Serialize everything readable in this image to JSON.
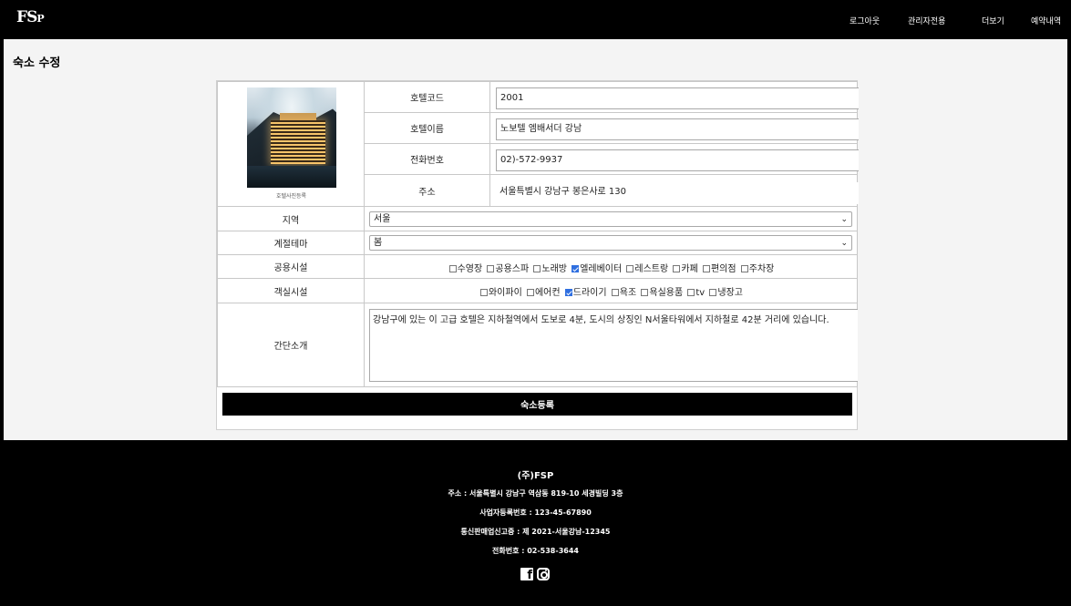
{
  "header": {
    "logo_main": "FS",
    "logo_small": "P",
    "nav": [
      {
        "label": "로그아웃"
      },
      {
        "label": "관리자전용"
      },
      {
        "label": "더보기"
      },
      {
        "label": "예약내역"
      }
    ]
  },
  "page": {
    "title": "숙소 수정"
  },
  "form": {
    "photo_caption": "호텔사진등록",
    "fields": [
      {
        "label": "호텔코드",
        "value": "2001"
      },
      {
        "label": "호텔이름",
        "value": "노보텔 엠배서더 강남"
      },
      {
        "label": "전화번호",
        "value": "02)-572-9937"
      },
      {
        "label": "주소",
        "value": "서울특별시 강남구 봉은사로 130"
      }
    ],
    "region": {
      "label": "지역",
      "selected": "서울"
    },
    "season": {
      "label": "계절테마",
      "selected": "봄"
    },
    "facilities": {
      "label": "공용시설",
      "options": [
        {
          "label": "수영장",
          "checked": false
        },
        {
          "label": "공용스파",
          "checked": false
        },
        {
          "label": "노래방",
          "checked": false
        },
        {
          "label": "엘레베이터",
          "checked": true
        },
        {
          "label": "레스트랑",
          "checked": false
        },
        {
          "label": "카페",
          "checked": false
        },
        {
          "label": "편의점",
          "checked": false
        },
        {
          "label": "주차장",
          "checked": false
        }
      ]
    },
    "room_amenities": {
      "label": "객실시설",
      "options": [
        {
          "label": "와이파이",
          "checked": false
        },
        {
          "label": "에어컨",
          "checked": false
        },
        {
          "label": "드라이기",
          "checked": true
        },
        {
          "label": "욕조",
          "checked": false
        },
        {
          "label": "욕실용품",
          "checked": false
        },
        {
          "label": "tv",
          "checked": false
        },
        {
          "label": "냉장고",
          "checked": false
        }
      ]
    },
    "intro": {
      "label": "간단소개",
      "value": "강남구에 있는 이 고급 호텔은 지하철역에서 도보로 4분, 도시의 상징인 N서울타워에서 지하철로 42분 거리에 있습니다."
    },
    "submit_label": "숙소등록"
  },
  "footer": {
    "company": "(주)FSP",
    "address": "주소 : 서울특별시 강남구 역삼동 819-10 세경빌딩 3층",
    "biz_no": "사업자등록번호 : 123-45-67890",
    "mail_order": "통신판매업신고증 : 제 2021-서울강남-12345",
    "phone": "전화번호 : 02-538-3644",
    "social_icons": [
      "facebook-icon",
      "instagram-icon"
    ]
  }
}
